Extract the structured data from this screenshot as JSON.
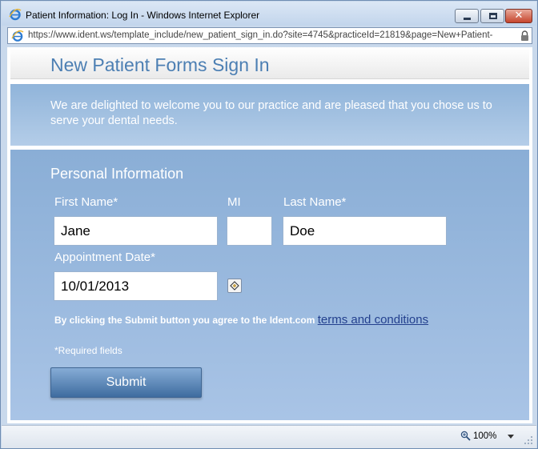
{
  "window": {
    "title": "Patient Information: Log In - Windows Internet Explorer",
    "icon": "ie-icon",
    "controls": [
      "minimize",
      "maximize",
      "close"
    ],
    "close_glyph": "✕"
  },
  "address_bar": {
    "url": "https://www.ident.ws/template_include/new_patient_sign_in.do?site=4745&practiceId=21819&page=New+Patient-",
    "secure_icon": "lock-icon"
  },
  "page": {
    "title": "New Patient Forms Sign In",
    "welcome": "We are delighted to welcome you to our practice and are pleased that you chose us to serve your dental needs.",
    "section_title": "Personal Information",
    "first_name": {
      "label": "First Name*",
      "value": "Jane"
    },
    "mi": {
      "label": "MI",
      "value": ""
    },
    "last_name": {
      "label": "Last Name*",
      "value": "Doe"
    },
    "appointment_date": {
      "label": "Appointment Date*",
      "value": "10/01/2013",
      "picker_icon": "calendar-icon"
    },
    "agree_text": "By clicking the Submit button you agree to the Ident.com",
    "terms_link": "terms and conditions",
    "required_note": "*Required fields",
    "submit_label": "Submit"
  },
  "status_bar": {
    "zoom": "100%",
    "zoom_icon": "zoom-icon"
  },
  "colors": {
    "title_blue": "#4c7fb3",
    "panel_blue": "#8aaed6",
    "button_blue": "#3e6c9f",
    "link_blue": "#23408e"
  }
}
